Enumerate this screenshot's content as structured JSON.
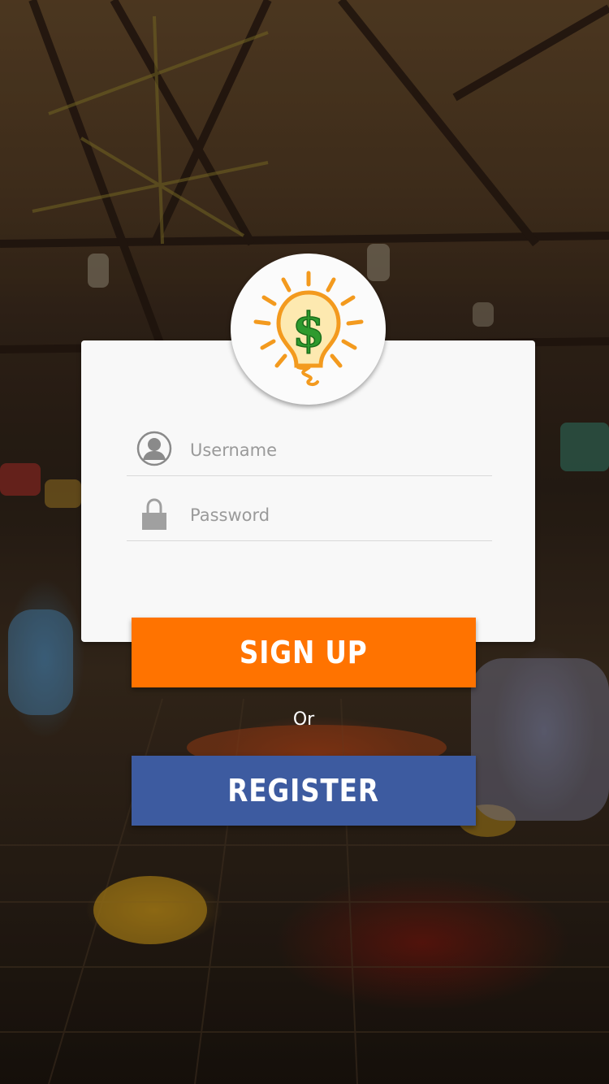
{
  "login": {
    "username_placeholder": "Username",
    "password_placeholder": "Password"
  },
  "buttons": {
    "signup_label": "SIGN UP",
    "or_label": "Or",
    "register_label": "REGISTER"
  },
  "icons": {
    "logo": "lightbulb-dollar-logo",
    "username": "user-icon",
    "password": "lock-icon"
  },
  "colors": {
    "signup_bg": "#ff7300",
    "register_bg": "#3d5ba0",
    "card_bg": "#f8f8f8",
    "logo_orange": "#f39a1e",
    "logo_green": "#2e9a2e"
  }
}
